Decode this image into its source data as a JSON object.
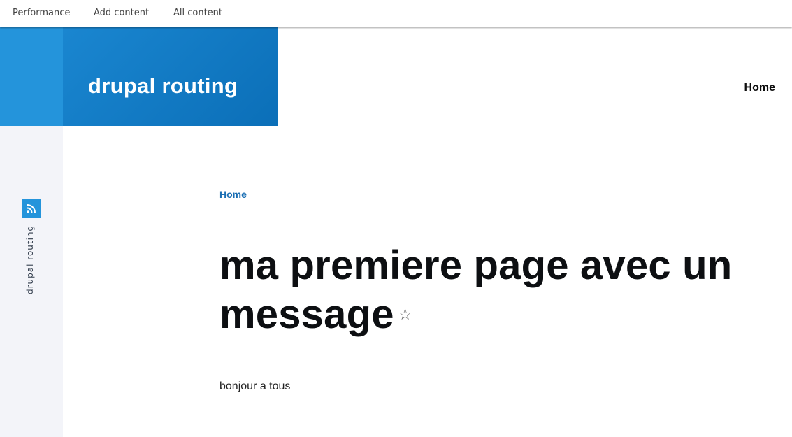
{
  "toolbar": {
    "items": [
      {
        "label": "Performance"
      },
      {
        "label": "Add content"
      },
      {
        "label": "All content"
      }
    ]
  },
  "sidebar": {
    "site_name_vertical": "drupal routing",
    "feed_icon": "rss-icon"
  },
  "branding": {
    "site_name": "drupal routing"
  },
  "main_nav": {
    "home_label": "Home"
  },
  "breadcrumb": {
    "home_label": "Home"
  },
  "page": {
    "title": "ma premiere page avec un message",
    "bookmark_icon": "star-icon",
    "body": "bonjour a tous"
  },
  "colors": {
    "accent": "#2494db",
    "branding": "#1177c2",
    "link": "#1a6eb3",
    "sidebar_bg": "#f3f4f9"
  }
}
